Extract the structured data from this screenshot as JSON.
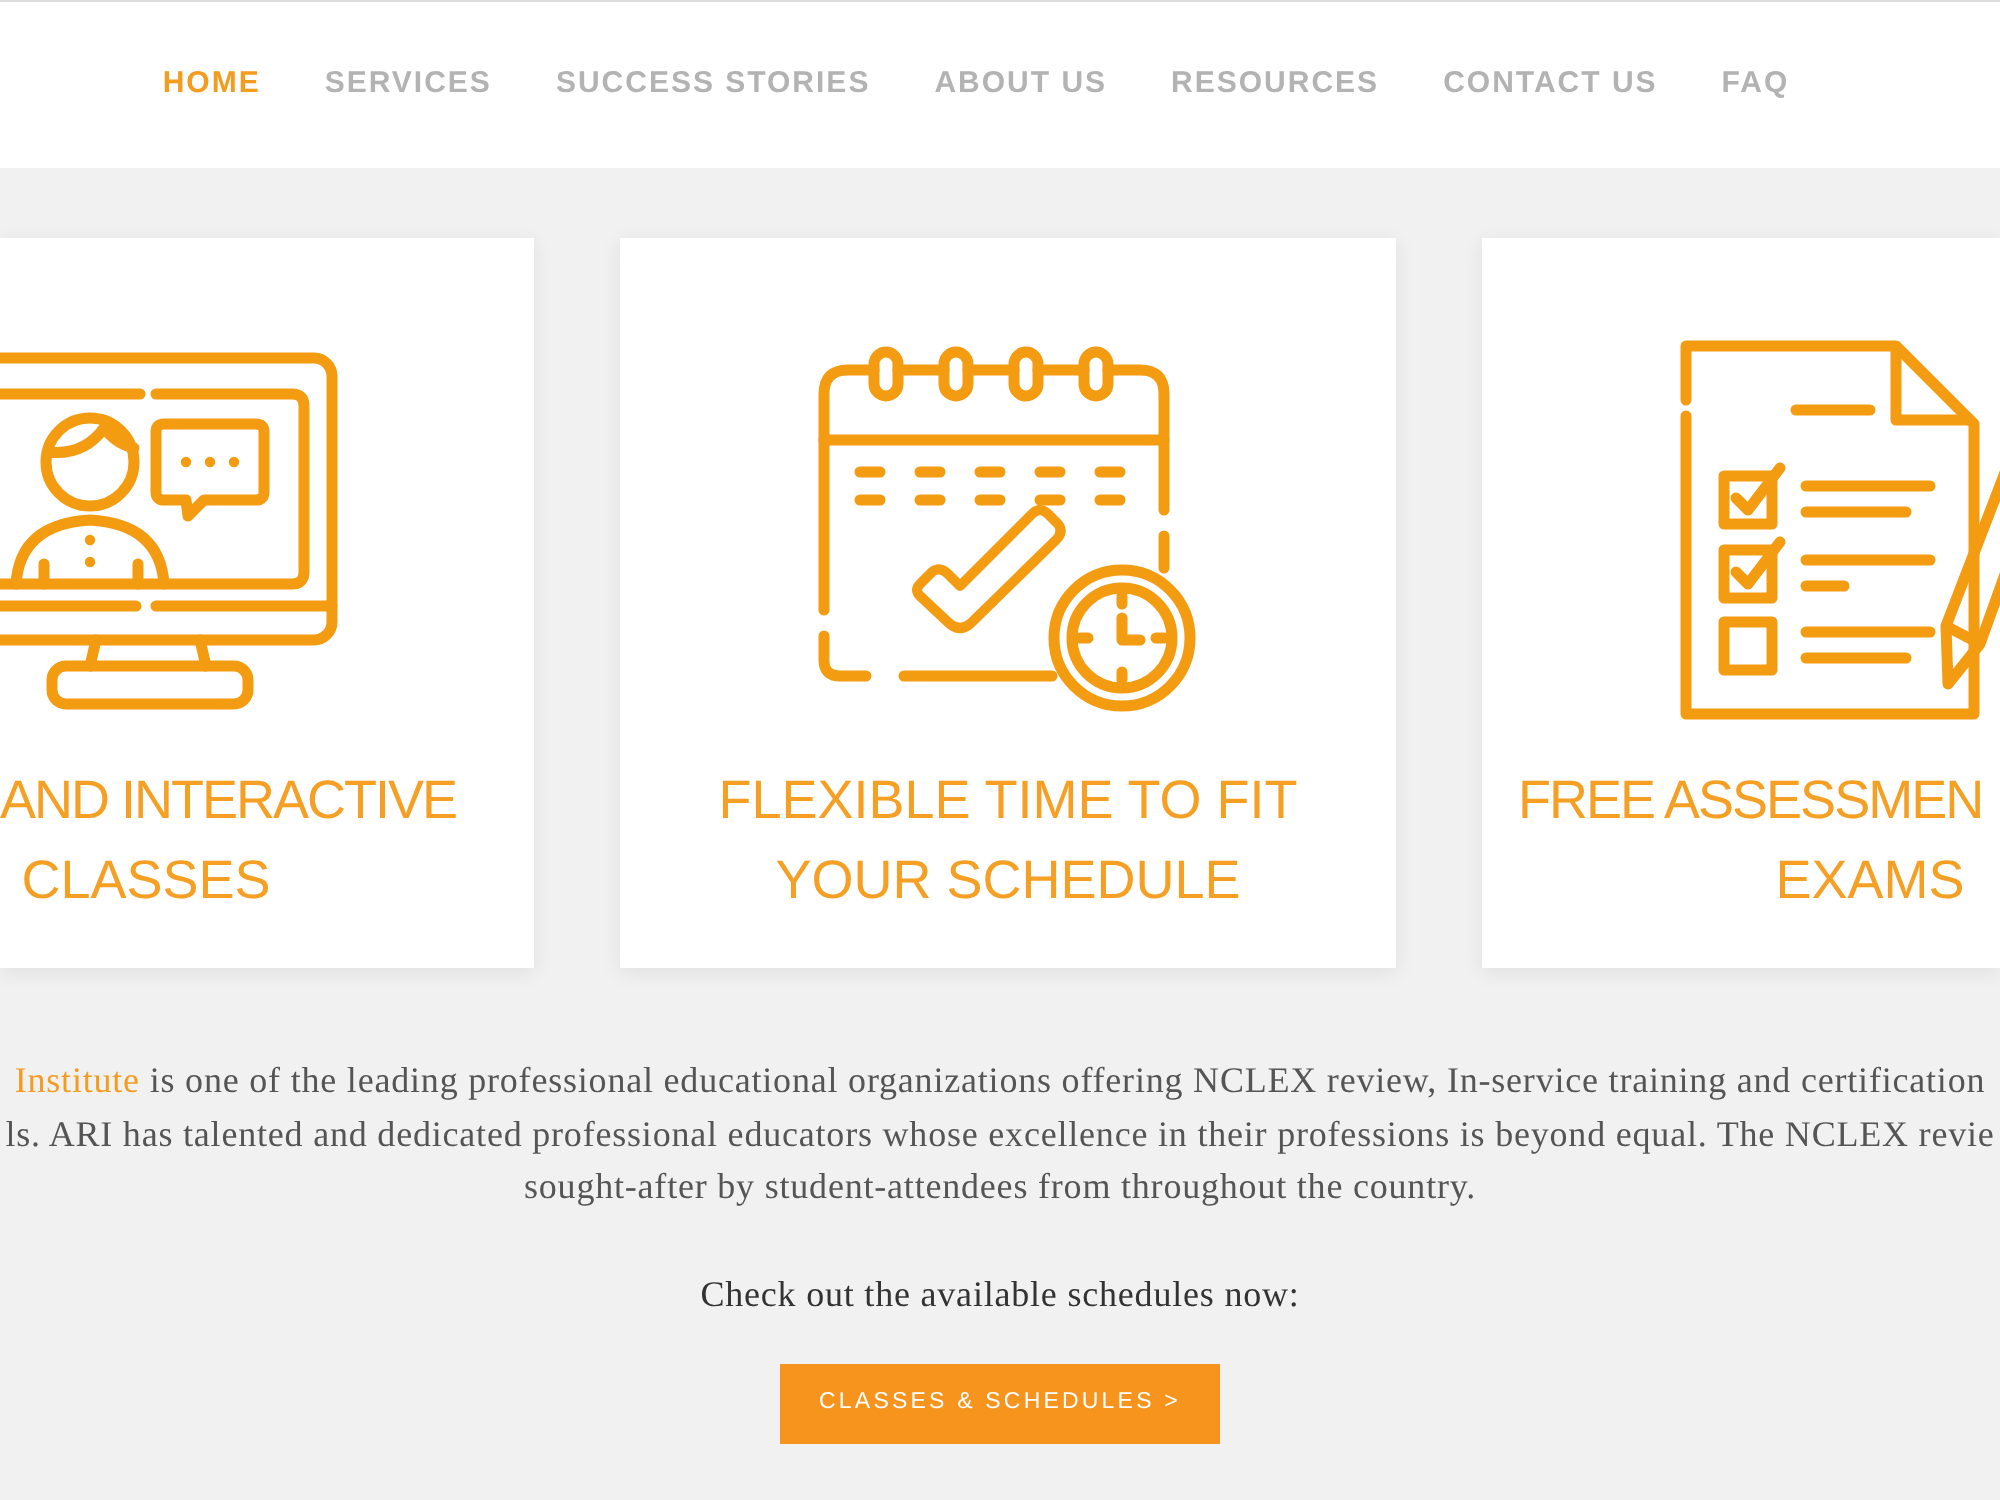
{
  "nav": {
    "items": [
      {
        "label": "HOME",
        "selected": true
      },
      {
        "label": "SERVICES",
        "selected": false
      },
      {
        "label": "SUCCESS STORIES",
        "selected": false
      },
      {
        "label": "ABOUT US",
        "selected": false
      },
      {
        "label": "RESOURCES",
        "selected": false
      },
      {
        "label": "CONTACT US",
        "selected": false
      },
      {
        "label": "FAQ",
        "selected": false
      }
    ]
  },
  "cards": [
    {
      "kind": "cut_left",
      "title_lines": [
        "AND INTERACTIVE",
        "CLASSES"
      ]
    },
    {
      "kind": "whole",
      "title_lines": [
        "FLEXIBLE TIME TO FIT",
        "YOUR SCHEDULE"
      ]
    },
    {
      "kind": "cut_right",
      "title_lines": [
        "FREE ASSESSMEN",
        "EXAMS"
      ]
    }
  ],
  "intro": {
    "link": "Institute",
    "lines": [
      "is one of the leading professional educational organizations offering NCLEX review, In-service training and certification",
      "ls. ARI has talented and dedicated professional educators whose excellence in their professions is beyond equal. The NCLEX revie",
      "sought-after by student-attendees from throughout the country."
    ]
  },
  "prompt": "Check out the available schedules now:",
  "button": {
    "label": "CLASSES & SCHEDULES >"
  }
}
